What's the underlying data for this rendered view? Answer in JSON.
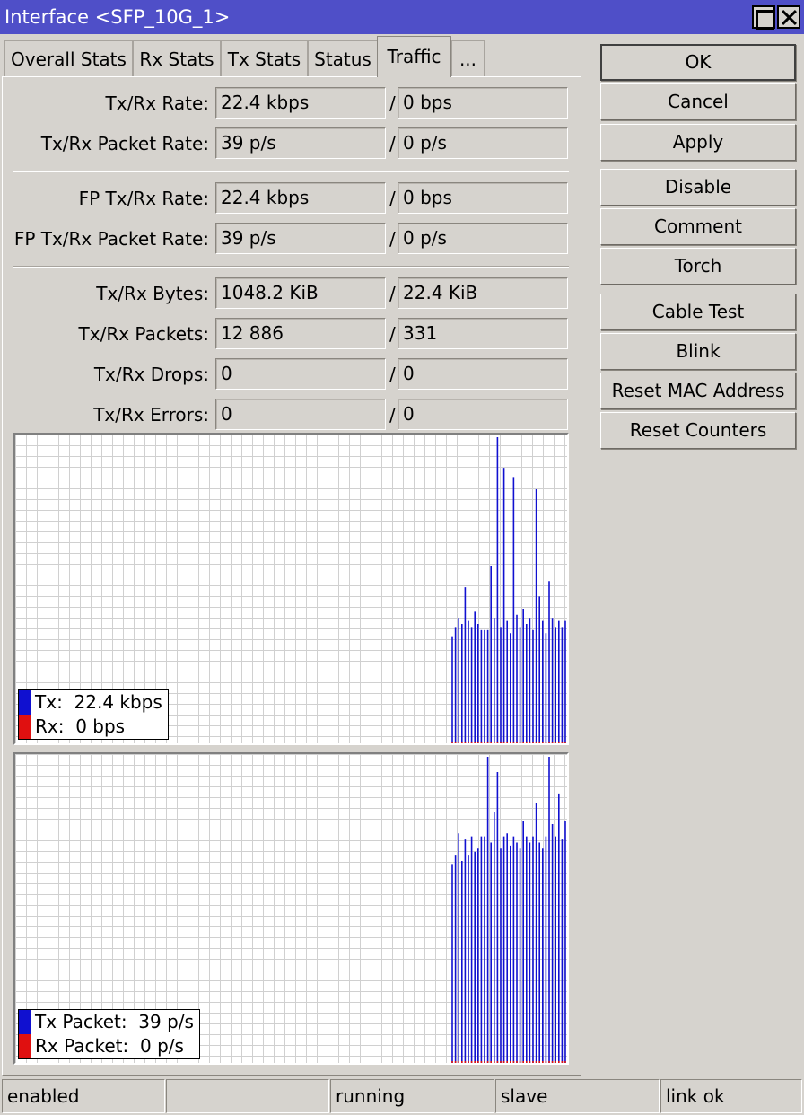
{
  "window": {
    "title": "Interface <SFP_10G_1>"
  },
  "tabs": [
    "Overall Stats",
    "Rx Stats",
    "Tx Stats",
    "Status",
    "Traffic",
    "..."
  ],
  "active_tab": "Traffic",
  "stats": {
    "tx_rx_rate": {
      "label": "Tx/Rx Rate:",
      "tx": "22.4 kbps",
      "rx": "0 bps"
    },
    "tx_rx_packet_rate": {
      "label": "Tx/Rx Packet Rate:",
      "tx": "39 p/s",
      "rx": "0 p/s"
    },
    "fp_tx_rx_rate": {
      "label": "FP Tx/Rx Rate:",
      "tx": "22.4 kbps",
      "rx": "0 bps"
    },
    "fp_tx_rx_packet_rate": {
      "label": "FP Tx/Rx Packet Rate:",
      "tx": "39 p/s",
      "rx": "0 p/s"
    },
    "tx_rx_bytes": {
      "label": "Tx/Rx Bytes:",
      "tx": "1048.2 KiB",
      "rx": "22.4 KiB"
    },
    "tx_rx_packets": {
      "label": "Tx/Rx Packets:",
      "tx": "12 886",
      "rx": "331"
    },
    "tx_rx_drops": {
      "label": "Tx/Rx Drops:",
      "tx": "0",
      "rx": "0"
    },
    "tx_rx_errors": {
      "label": "Tx/Rx Errors:",
      "tx": "0",
      "rx": "0"
    },
    "separator": "/"
  },
  "buttons": {
    "ok": "OK",
    "cancel": "Cancel",
    "apply": "Apply",
    "disable": "Disable",
    "comment": "Comment",
    "torch": "Torch",
    "cable_test": "Cable Test",
    "blink": "Blink",
    "reset_mac": "Reset MAC Address",
    "reset_counters": "Reset Counters"
  },
  "status_bar": [
    "enabled",
    "",
    "running",
    "slave",
    "link ok"
  ],
  "colors": {
    "tx": "#1010d0",
    "rx": "#e01010",
    "title_bar": "#4f4fc8"
  },
  "chart_data": [
    {
      "type": "bar",
      "series": [
        {
          "name": "Tx",
          "legend_value": "22.4 kbps",
          "values": [
            0.35,
            0.38,
            0.41,
            0.39,
            0.51,
            0.4,
            0.38,
            0.43,
            0.39,
            0.37,
            0.37,
            0.37,
            0.58,
            0.41,
            1.0,
            0.38,
            0.9,
            0.4,
            0.36,
            0.87,
            0.42,
            0.38,
            0.44,
            0.39,
            0.41,
            0.37,
            0.83,
            0.48,
            0.4,
            0.36,
            0.53,
            0.41,
            0.38,
            0.4,
            0.38,
            0.4,
            0.36
          ]
        },
        {
          "name": "Rx",
          "legend_value": "0 bps",
          "values": [
            0,
            0,
            0,
            0,
            0,
            0,
            0,
            0,
            0,
            0,
            0,
            0,
            0,
            0,
            0,
            0,
            0,
            0,
            0,
            0,
            0,
            0,
            0,
            0,
            0,
            0,
            0,
            0,
            0,
            0,
            0,
            0,
            0,
            0,
            0,
            0,
            0.07
          ]
        }
      ]
    },
    {
      "type": "bar",
      "series": [
        {
          "name": "Tx Packet",
          "legend_value": "39 p/s",
          "values": [
            0.65,
            0.68,
            0.75,
            0.66,
            0.73,
            0.68,
            0.74,
            0.69,
            0.7,
            0.74,
            0.74,
            1.0,
            0.72,
            0.82,
            0.95,
            0.7,
            0.74,
            0.75,
            0.71,
            0.74,
            0.72,
            0.7,
            0.79,
            0.74,
            0.72,
            0.74,
            0.85,
            0.72,
            0.7,
            0.74,
            1.0,
            0.78,
            0.74,
            0.88,
            0.73,
            0.79,
            0.68
          ]
        },
        {
          "name": "Rx Packet",
          "legend_value": "0 p/s",
          "values": [
            0,
            0,
            0,
            0,
            0,
            0,
            0,
            0,
            0,
            0,
            0,
            0,
            0,
            0,
            0,
            0,
            0,
            0,
            0,
            0,
            0,
            0,
            0,
            0,
            0,
            0,
            0,
            0,
            0,
            0,
            0,
            0,
            0,
            0,
            0,
            0,
            0.07
          ]
        }
      ]
    }
  ]
}
